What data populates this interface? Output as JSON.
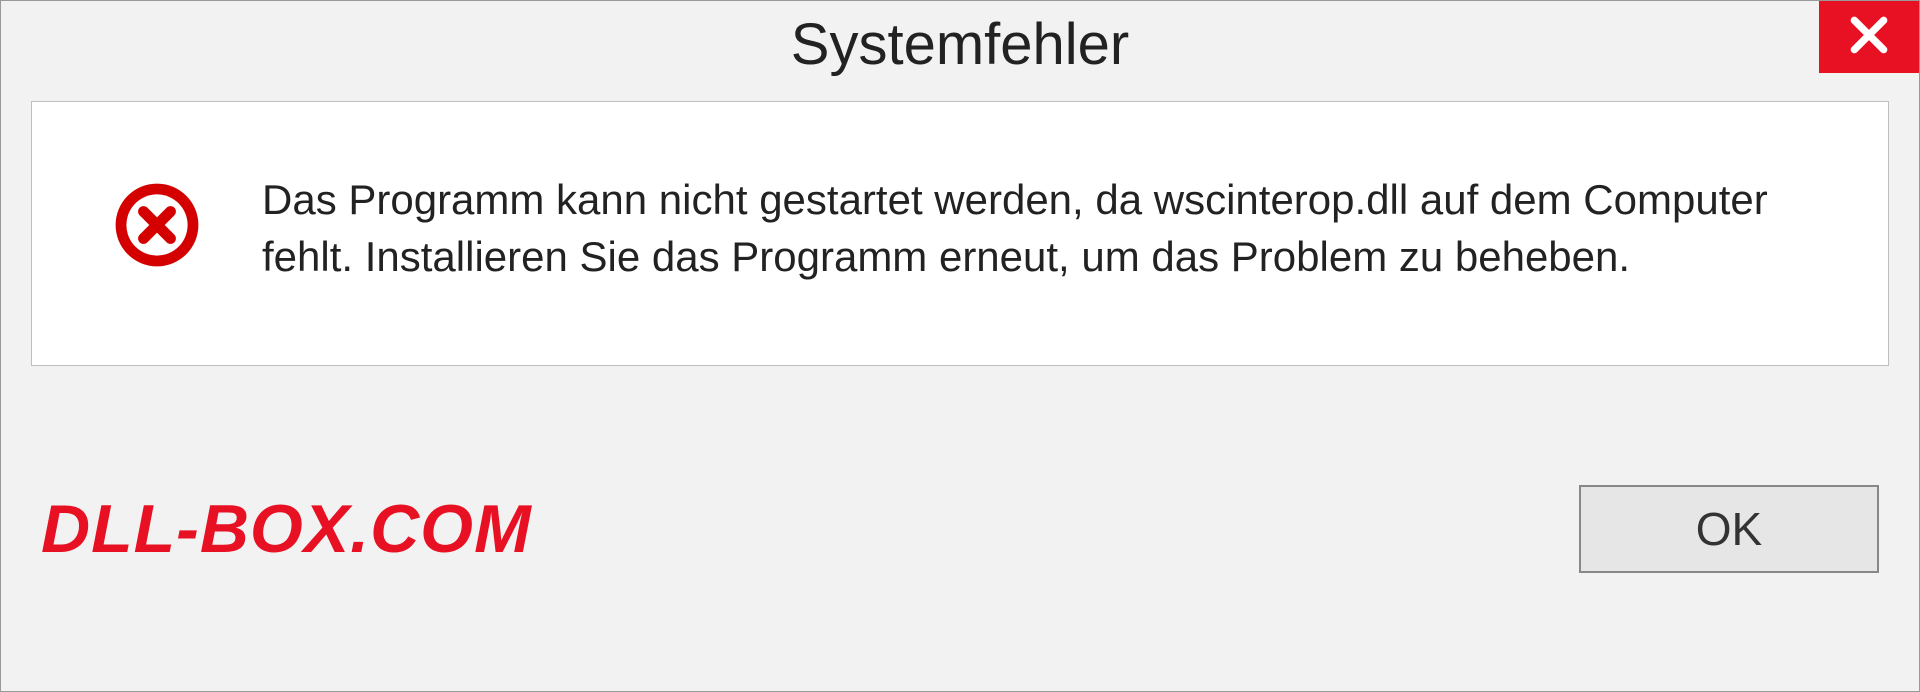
{
  "dialog": {
    "title": "Systemfehler",
    "message": "Das Programm kann nicht gestartet werden, da wscinterop.dll auf dem Computer fehlt. Installieren Sie das Programm erneut, um das Problem zu beheben.",
    "ok_label": "OK"
  },
  "watermark": "DLL-BOX.COM",
  "colors": {
    "close_bg": "#e81123",
    "error_icon": "#d40000",
    "watermark": "#e81123"
  }
}
